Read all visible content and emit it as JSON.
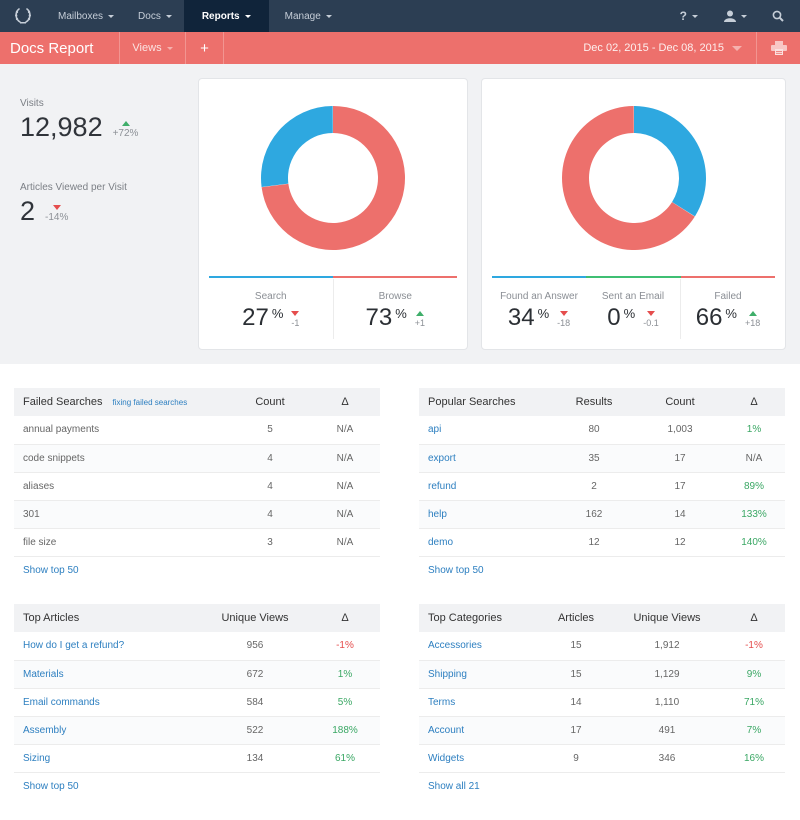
{
  "nav": {
    "items": [
      {
        "label": "Mailboxes",
        "active": false
      },
      {
        "label": "Docs",
        "active": false
      },
      {
        "label": "Reports",
        "active": true
      },
      {
        "label": "Manage",
        "active": false
      }
    ],
    "help_label": "?",
    "icons": [
      "logo-wreath-icon",
      "help-icon",
      "user-icon",
      "search-icon"
    ]
  },
  "report_bar": {
    "title": "Docs Report",
    "views_label": "Views",
    "add_label": "+",
    "date_range": "Dec 02, 2015 - Dec 08, 2015",
    "print_icon": "print-icon"
  },
  "stats": {
    "visits": {
      "label": "Visits",
      "value": "12,982",
      "delta": "+72%",
      "direction": "up"
    },
    "articles_per_visit": {
      "label": "Articles Viewed per Visit",
      "value": "2",
      "delta": "-14%",
      "direction": "down"
    }
  },
  "colors": {
    "blue": "#2ea8e0",
    "red": "#ed706c",
    "green": "#3fbf73",
    "nav_bg": "#2c3e53",
    "link": "#2d7fc0"
  },
  "chart_data": [
    {
      "type": "pie",
      "title": "",
      "categories": [
        "Search",
        "Browse"
      ],
      "values": [
        27,
        73
      ],
      "colors": [
        "#2ea8e0",
        "#ed706c"
      ],
      "deltas": [
        "-1",
        "+1"
      ],
      "directions": [
        "down",
        "up"
      ],
      "unit": "%"
    },
    {
      "type": "pie",
      "title": "",
      "categories": [
        "Found an Answer",
        "Sent an Email",
        "Failed"
      ],
      "values": [
        34,
        0,
        66
      ],
      "colors": [
        "#2ea8e0",
        "#3fbf73",
        "#ed706c"
      ],
      "deltas": [
        "-18",
        "-0.1",
        "+18"
      ],
      "directions": [
        "down",
        "down",
        "up"
      ],
      "unit": "%"
    }
  ],
  "failed_searches": {
    "title": "Failed Searches",
    "help_link": "fixing failed searches",
    "columns": [
      "Failed Searches",
      "Count",
      "Δ"
    ],
    "rows": [
      {
        "term": "annual payments",
        "count": "5",
        "delta": "N/A"
      },
      {
        "term": "code snippets",
        "count": "4",
        "delta": "N/A"
      },
      {
        "term": "aliases",
        "count": "4",
        "delta": "N/A"
      },
      {
        "term": "301",
        "count": "4",
        "delta": "N/A"
      },
      {
        "term": "file size",
        "count": "3",
        "delta": "N/A"
      }
    ],
    "show_more": "Show top 50"
  },
  "popular_searches": {
    "columns": [
      "Popular Searches",
      "Results",
      "Count",
      "Δ"
    ],
    "rows": [
      {
        "term": "api",
        "results": "80",
        "count": "1,003",
        "delta": "1%",
        "tone": "pos"
      },
      {
        "term": "export",
        "results": "35",
        "count": "17",
        "delta": "N/A",
        "tone": ""
      },
      {
        "term": "refund",
        "results": "2",
        "count": "17",
        "delta": "89%",
        "tone": "pos"
      },
      {
        "term": "help",
        "results": "162",
        "count": "14",
        "delta": "133%",
        "tone": "pos"
      },
      {
        "term": "demo",
        "results": "12",
        "count": "12",
        "delta": "140%",
        "tone": "pos"
      }
    ],
    "show_more": "Show top 50"
  },
  "top_articles": {
    "columns": [
      "Top Articles",
      "Unique Views",
      "Δ"
    ],
    "rows": [
      {
        "title": "How do I get a refund?",
        "views": "956",
        "delta": "-1%",
        "tone": "neg"
      },
      {
        "title": "Materials",
        "views": "672",
        "delta": "1%",
        "tone": "pos"
      },
      {
        "title": "Email commands",
        "views": "584",
        "delta": "5%",
        "tone": "pos"
      },
      {
        "title": "Assembly",
        "views": "522",
        "delta": "188%",
        "tone": "pos"
      },
      {
        "title": "Sizing",
        "views": "134",
        "delta": "61%",
        "tone": "pos"
      }
    ],
    "show_more": "Show top 50"
  },
  "top_categories": {
    "columns": [
      "Top Categories",
      "Articles",
      "Unique Views",
      "Δ"
    ],
    "rows": [
      {
        "name": "Accessories",
        "articles": "15",
        "views": "1,912",
        "delta": "-1%",
        "tone": "neg"
      },
      {
        "name": "Shipping",
        "articles": "15",
        "views": "1,129",
        "delta": "9%",
        "tone": "pos"
      },
      {
        "name": "Terms",
        "articles": "14",
        "views": "1,110",
        "delta": "71%",
        "tone": "pos"
      },
      {
        "name": "Account",
        "articles": "17",
        "views": "491",
        "delta": "7%",
        "tone": "pos"
      },
      {
        "name": "Widgets",
        "articles": "9",
        "views": "346",
        "delta": "16%",
        "tone": "pos"
      }
    ],
    "show_more": "Show all 21"
  }
}
